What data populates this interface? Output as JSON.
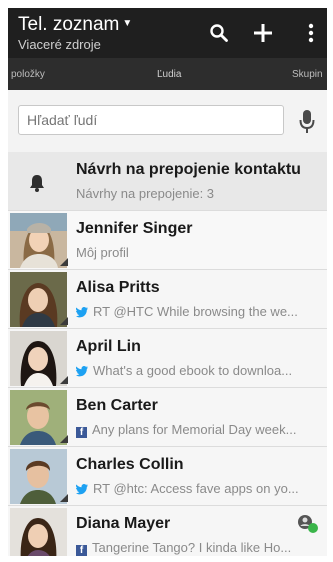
{
  "header": {
    "title": "Tel. zoznam",
    "subtitle": "Viaceré zdroje",
    "icons": [
      "search-icon",
      "add-icon",
      "overflow-menu-icon"
    ]
  },
  "tabs": [
    {
      "label": "položky"
    },
    {
      "label": "Ľudia"
    },
    {
      "label": "Skupin"
    }
  ],
  "search": {
    "placeholder": "Hľadať ľudí"
  },
  "suggestion": {
    "title": "Návrh na prepojenie kontaktu",
    "subtitle": "Návrhy na prepojenie: 3"
  },
  "profile": {
    "name": "Jennifer Singer",
    "subtitle": "Môj profil"
  },
  "contacts": [
    {
      "name": "Alisa Pritts",
      "source": "twitter",
      "status": "RT @HTC While browsing the we..."
    },
    {
      "name": "April Lin",
      "source": "twitter",
      "status": "What's a good ebook to downloa..."
    },
    {
      "name": "Ben Carter",
      "source": "facebook",
      "status": "Any plans for Memorial Day week..."
    },
    {
      "name": "Charles Collin",
      "source": "twitter",
      "status": "RT @htc: Access fave apps on yo..."
    },
    {
      "name": "Diana Mayer",
      "source": "facebook",
      "status": "Tangerine Tango? I kinda like Ho..."
    }
  ],
  "colors": {
    "twitter": "#1da1f2",
    "facebook": "#3b5998",
    "online": "#3ab54a"
  }
}
